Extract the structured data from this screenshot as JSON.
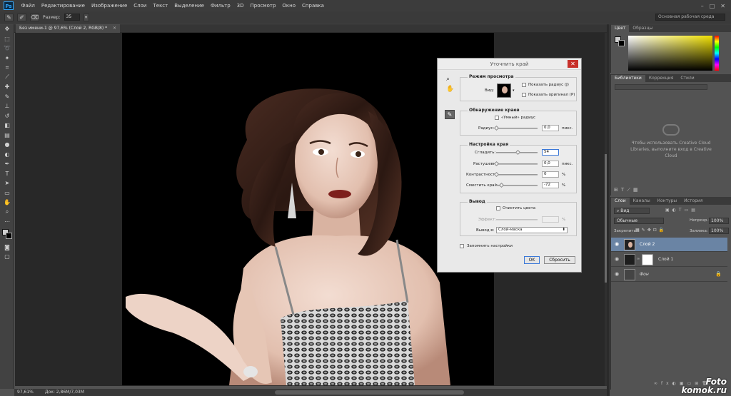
{
  "app": {
    "logo": "Ps"
  },
  "menu": [
    "Файл",
    "Редактирование",
    "Изображение",
    "Слои",
    "Текст",
    "Выделение",
    "Фильтр",
    "3D",
    "Просмотр",
    "Окно",
    "Справка"
  ],
  "options_bar": {
    "size_label": "Размер:",
    "size_value": "35",
    "workspace": "Основная рабочая среда"
  },
  "document": {
    "tab_title": "Без имени-1 @ 97,6% (Слой 2, RGB/8) *",
    "zoom": "97,61%",
    "doc_size": "Док: 2,86M/7,03M"
  },
  "color_panel": {
    "tabs": [
      "Цвет",
      "Образцы"
    ]
  },
  "libraries_panel": {
    "tabs": [
      "Библиотеки",
      "Коррекция",
      "Стили"
    ],
    "message": "Чтобы использовать Creative Cloud Libraries, выполните вход в Creative Cloud"
  },
  "layers_panel": {
    "tabs": [
      "Слои",
      "Каналы",
      "Контуры",
      "История"
    ],
    "filter_kind": "Вид",
    "blend_mode": "Обычные",
    "opacity_label": "Непрозр.:",
    "opacity_value": "100%",
    "lock_label": "Закрепить:",
    "fill_label": "Заливка:",
    "fill_value": "100%",
    "layers": [
      {
        "name": "Слой 2",
        "selected": true
      },
      {
        "name": "Слой 1",
        "selected": false
      },
      {
        "name": "Фон",
        "selected": false
      }
    ]
  },
  "dialog": {
    "title": "Уточнить край",
    "view_mode": {
      "heading": "Режим просмотра",
      "view_label": "Вид:",
      "show_radius": "Показать радиус (J)",
      "show_original": "Показать оригинал (P)"
    },
    "edge_detection": {
      "heading": "Обнаружение краев",
      "smart_radius": "«Умный» радиус",
      "radius_label": "Радиус:",
      "radius_value": "0,0",
      "radius_unit": "пикс."
    },
    "adjust_edge": {
      "heading": "Настройка края",
      "smooth_label": "Сгладить:",
      "smooth_value": "54",
      "smooth": 0.54,
      "feather_label": "Растушевка:",
      "feather_value": "0,0",
      "feather_unit": "пикс.",
      "contrast_label": "Контрастность:",
      "contrast_value": "0",
      "contrast_unit": "%",
      "shift_label": "Сместить край:",
      "shift_value": "-72",
      "shift_unit": "%",
      "shift": -72
    },
    "output": {
      "heading": "Вывод",
      "decontaminate": "Очистить цвета",
      "amount_label": "Эффект:",
      "amount_unit": "%",
      "output_to_label": "Вывод в:",
      "output_to_value": "Слой-маска"
    },
    "remember": "Запомнить настройки",
    "ok": "OK",
    "reset": "Сбросить"
  },
  "watermark": {
    "line1": "Foto",
    "line2": "komok.ru"
  }
}
